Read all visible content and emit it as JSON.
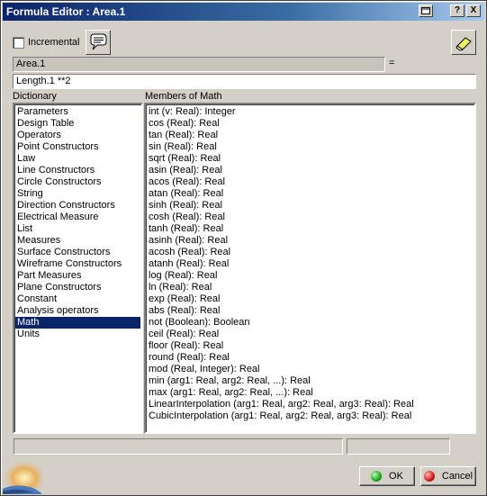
{
  "window": {
    "title": "Formula Editor : Area.1"
  },
  "title_buttons": {
    "menu": "",
    "help": "?",
    "close": "X"
  },
  "incremental": {
    "label": "Incremental",
    "checked": false
  },
  "parameter_field": {
    "value": "Area.1"
  },
  "equals_sign": "=",
  "formula_field": {
    "value": "Length.1 **2"
  },
  "dictionary": {
    "header": "Dictionary",
    "selected": "Math",
    "items": [
      "Parameters",
      "Design Table",
      "Operators",
      "Point Constructors",
      "Law",
      "Line Constructors",
      "Circle Constructors",
      "String",
      "Direction Constructors",
      "Electrical Measure",
      "List",
      "Measures",
      "Surface Constructors",
      "Wireframe Constructors",
      "Part Measures",
      "Plane Constructors",
      "Constant",
      "Analysis operators",
      "Math",
      "Units"
    ]
  },
  "members": {
    "header": "Members of Math",
    "items": [
      "int (v: Real): Integer",
      "cos (Real): Real",
      "tan (Real): Real",
      "sin (Real): Real",
      "sqrt (Real): Real",
      "asin (Real): Real",
      "acos (Real): Real",
      "atan (Real): Real",
      "sinh (Real): Real",
      "cosh (Real): Real",
      "tanh (Real): Real",
      "asinh (Real): Real",
      "acosh (Real): Real",
      "atanh (Real): Real",
      "log (Real): Real",
      "ln (Real): Real",
      "exp (Real): Real",
      "abs (Real): Real",
      "not (Boolean): Boolean",
      "ceil (Real): Real",
      "floor (Real): Real",
      "round (Real): Real",
      "mod (Real, Integer): Real",
      "min (arg1: Real, arg2: Real, ...): Real",
      "max (arg1: Real, arg2: Real, ...): Real",
      "LinearInterpolation (arg1: Real, arg2: Real, arg3: Real): Real",
      "CubicInterpolation (arg1: Real, arg2: Real, arg3: Real): Real"
    ]
  },
  "buttons": {
    "ok": "OK",
    "cancel": "Cancel"
  },
  "colors": {
    "title_bar": "#0a246a",
    "selection": "#0a246a",
    "ok_dot": "#1aa31a",
    "cancel_dot": "#d01818",
    "face": "#d4d0c8"
  }
}
